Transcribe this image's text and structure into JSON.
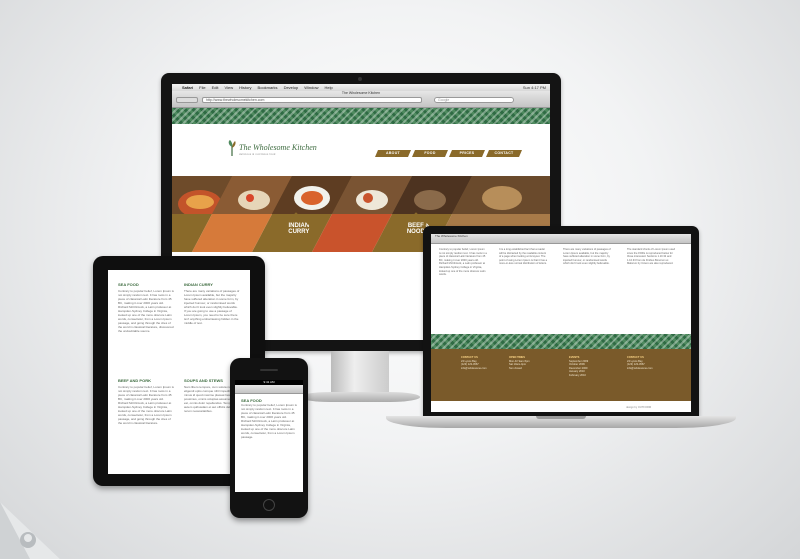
{
  "colors": {
    "brand_green": "#3d6b3f",
    "wave_dark": "#2f6b44",
    "wave_light": "#4f8a5f",
    "nav_brown": "#8a6a2a",
    "footer_brown": "#7a5a2a"
  },
  "desktop": {
    "menubar": {
      "items": [
        "Safari",
        "File",
        "Edit",
        "View",
        "History",
        "Bookmarks",
        "Develop",
        "Window",
        "Help"
      ],
      "clock": "Sun 4:17 PM"
    },
    "browser": {
      "window_title": "The Wholesome Kitchen",
      "url": "http://www.thewholesomekitchen.com",
      "search_placeholder": "Google"
    },
    "site": {
      "logo_text": "The Wholesome Kitchen",
      "logo_tagline": "delicious & nutritious food",
      "nav": [
        "ABOUT",
        "FOOD",
        "PRICES",
        "CONTACT"
      ],
      "hero_tags": [
        "INDIAN CURRY",
        "BEEF & NOODLE"
      ]
    }
  },
  "tablet": {
    "sections": [
      {
        "heading": "SEA FOOD",
        "text": "Contrary to popular belief, Lorem Ipsum is not simply random text. It has roots in a piece of classical Latin literature from 45 BC, making it over 2000 years old. Richard McClintock, a Latin professor at Hampden-Sydney College in Virginia, looked up one of the more obscure Latin words, consectetur, from a Lorem Ipsum passage, and going through the cites of the word in classical literature, discovered the undoubtable source."
      },
      {
        "heading": "INDIAN CURRY",
        "text": "There are many variations of passages of Lorem Ipsum available, but the majority have suffered alteration in some form, by injected humour, or randomised words which don't look even slightly believable. If you are going to use a passage of Lorem Ipsum, you need to be sure there isn't anything embarrassing hidden in the middle of text."
      },
      {
        "heading": "BEEF AND PORK",
        "text": "Contrary to popular belief, Lorem Ipsum is not simply random text. It has roots in a piece of classical Latin literature from 45 BC, making it over 2000 years old. Richard McClintock, a Latin professor at Hampden-Sydney College in Virginia, looked up one of the more obscure Latin words, consectetur, from a Lorem Ipsum passage, and going through the cites of the word in classical literature."
      },
      {
        "heading": "SOUPS AND STEWS",
        "text": "Nam libero tempore, cum soluta nobis est eligendi optio cumque nihil impedit quo minus id quod maxime placeat facere possimus, omnis voluptas assumenda est, omnis dolor repellendus. Temporibus autem quibusdam et aut officiis debitis aut rerum necessitatibus."
      }
    ]
  },
  "laptop": {
    "browser_title": "The Wholesome Kitchen",
    "columns": [
      "Contrary to popular belief, Lorem Ipsum is not simply random text. It has roots in a piece of classical Latin literature from 45 BC, making it over 2000 years old. Richard McClintock, a Latin professor at Hampden-Sydney College in Virginia, looked up one of the more obscure Latin words.",
      "It is a long established fact that a reader will be distracted by the readable content of a page when looking at its layout. The point of using Lorem Ipsum is that it has a more-or-less normal distribution of letters.",
      "There are many variations of passages of Lorem Ipsum available, but the majority have suffered alteration in some form, by injected humour, or randomised words which don't look even slightly believable.",
      "The standard chunk of Lorem Ipsum used since the 1500s is reproduced below for those interested. Sections 1.10.32 and 1.10.33 from de Finibus Bonorum et Malorum by Cicero are also reproduced."
    ],
    "footer": [
      {
        "heading": "CONTACT US",
        "lines": [
          "24 Lyons Bay",
          "(123) 123-4567",
          "info@wholesome.com"
        ]
      },
      {
        "heading": "OPEN TIMES",
        "lines": [
          "Mon-Fri 9am-5pm",
          "Sat 10am-4pm",
          "Sun closed"
        ]
      },
      {
        "heading": "EVENTS",
        "lines": [
          "September 2009",
          "October 2009",
          "December 2009",
          "January 2010",
          "February 2010"
        ]
      },
      {
        "heading": "CONTACT US",
        "lines": [
          "24 Lyons Bay",
          "(123) 123-4567",
          "info@wholesome.com"
        ]
      }
    ],
    "credit": "design by OUTFORM"
  },
  "phone": {
    "status": "9:41 AM",
    "heading": "SEA FOOD",
    "text": "Contrary to popular belief, Lorem Ipsum is not simply random text. It has roots in a piece of classical Latin literature from 45 BC, making it over 2000 years old. Richard McClintock, a Latin professor at Hampden-Sydney College in Virginia, looked up one of the more obscure Latin words, consectetur, from a Lorem Ipsum passage."
  }
}
